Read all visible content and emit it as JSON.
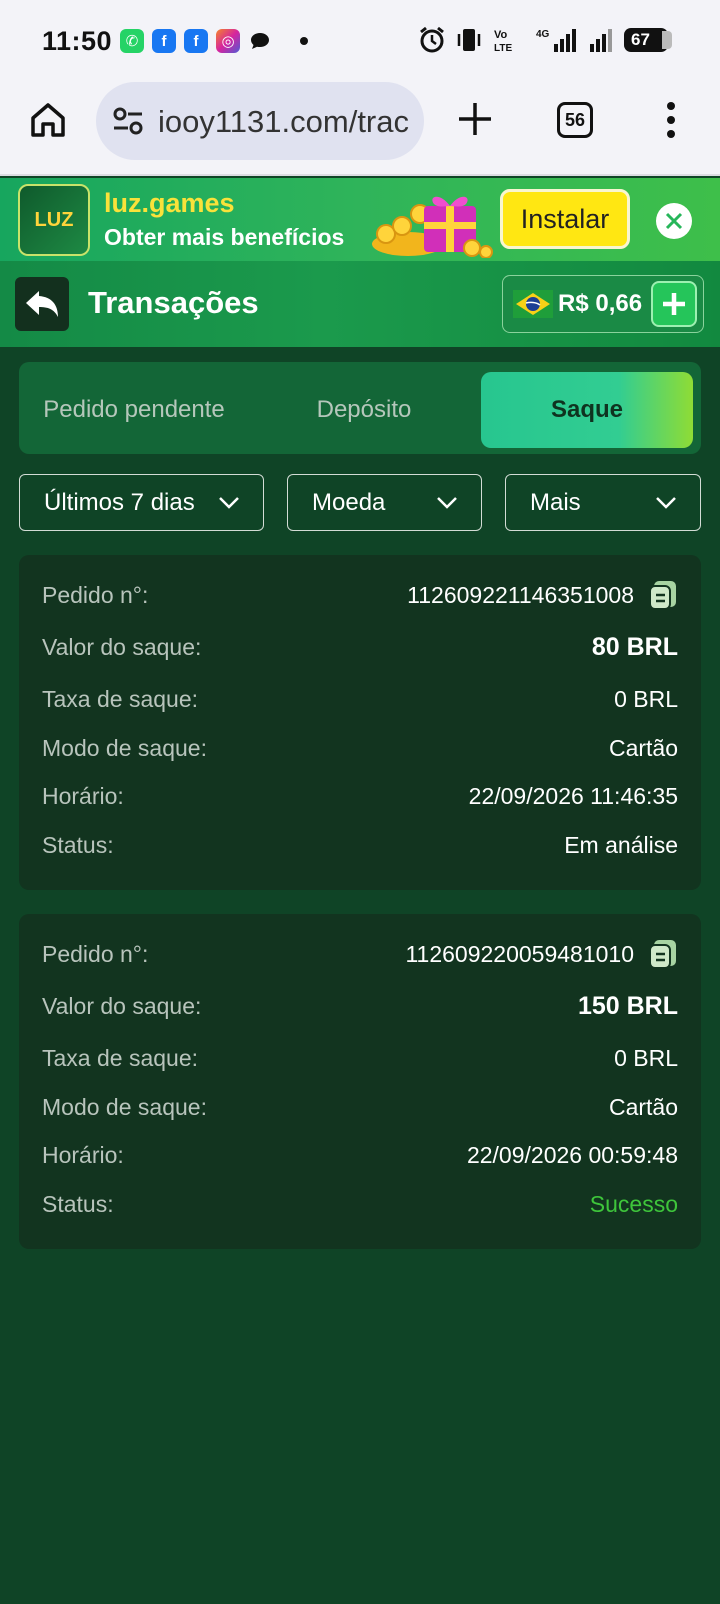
{
  "status_bar": {
    "time": "11:50",
    "battery": "67",
    "apps": [
      {
        "name": "whatsapp-icon",
        "glyph": "✆",
        "color": "#25d366"
      },
      {
        "name": "facebook-icon",
        "glyph": "f",
        "color": "#1877f2"
      },
      {
        "name": "facebook-icon",
        "glyph": "f",
        "color": "#1877f2"
      },
      {
        "name": "instagram-icon",
        "glyph": "◎",
        "color": "#d6249f"
      }
    ]
  },
  "browser": {
    "url": "iooy1131.com/trac",
    "tab_count": "56"
  },
  "banner": {
    "app_name": "luz.games",
    "subtitle": "Obter mais benefícios",
    "install_label": "Instalar",
    "logo_text": "LUZ"
  },
  "header": {
    "title": "Transações",
    "balance": "R$ 0,66"
  },
  "tabs": [
    {
      "label": "Pedido pendente",
      "active": false
    },
    {
      "label": "Depósito",
      "active": false
    },
    {
      "label": "Saque",
      "active": true
    }
  ],
  "filters": {
    "period": "Últimos 7 dias",
    "currency": "Moeda",
    "more": "Mais"
  },
  "labels": {
    "order_no": "Pedido n°:",
    "amount": "Valor do saque:",
    "fee": "Taxa de saque:",
    "mode": "Modo de saque:",
    "time": "Horário:",
    "status": "Status:"
  },
  "transactions": [
    {
      "order_no": "112609221146351008",
      "amount": "80 BRL",
      "fee": "0 BRL",
      "mode": "Cartão",
      "time": "22/09/2026 11:46:35",
      "status": "Em análise",
      "status_color": "#ffffff"
    },
    {
      "order_no": "112609220059481010",
      "amount": "150 BRL",
      "fee": "0 BRL",
      "mode": "Cartão",
      "time": "22/09/2026 00:59:48",
      "status": "Sucesso",
      "status_color": "#3ec53b"
    }
  ]
}
